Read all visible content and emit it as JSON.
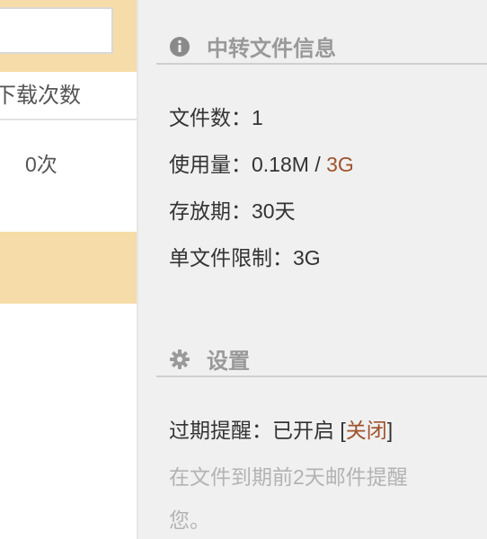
{
  "left": {
    "search_value": "",
    "column_header": "下载次数",
    "download_count": "0次"
  },
  "info_section": {
    "title": "中转文件信息",
    "icon": "info-icon",
    "file_count": "文件数：1",
    "usage_label": "使用量：0.18M / ",
    "usage_quota": "3G",
    "retention": "存放期：30天",
    "single_limit": "单文件限制：3G"
  },
  "settings_section": {
    "title": "设置",
    "icon": "gear-icon",
    "reminder_label": "过期提醒：已开启 ",
    "reminder_bracket_open": "[",
    "reminder_toggle": "关闭",
    "reminder_bracket_close": "]",
    "reminder_desc_line1": "在文件到期前2天邮件提醒",
    "reminder_desc_line2": "您。"
  },
  "colors": {
    "accent": "#a0522d",
    "highlight_bar": "#f6dca9",
    "panel_bg": "#f0f0f0",
    "muted_text": "#b3b3b3"
  }
}
